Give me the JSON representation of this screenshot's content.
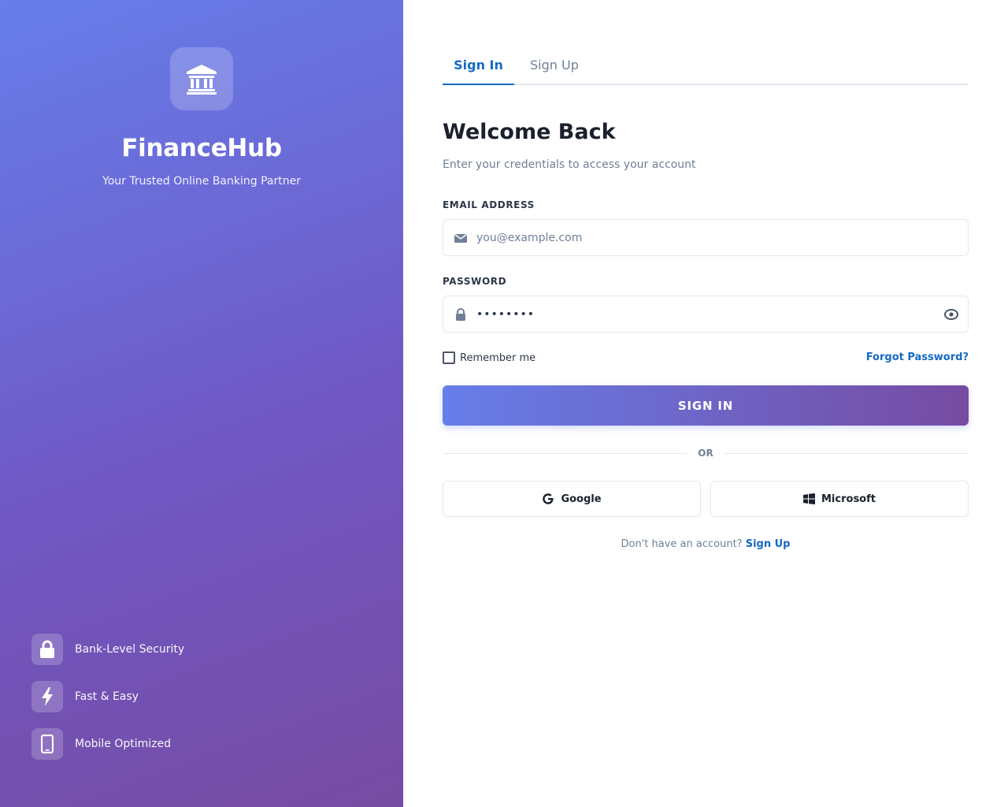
{
  "brand": {
    "name": "FinanceHub",
    "tagline": "Your Trusted Online Banking Partner",
    "logo_icon": "bank-icon"
  },
  "features": [
    {
      "label": "Bank-Level Security",
      "icon": "lock-icon"
    },
    {
      "label": "Fast & Easy",
      "icon": "lightning-bolt-icon"
    },
    {
      "label": "Mobile Optimized",
      "icon": "mobile-phone-icon"
    }
  ],
  "tabs": {
    "sign_in": "Sign In",
    "sign_up": "Sign Up",
    "active": "Sign In"
  },
  "form": {
    "title": "Welcome Back",
    "subtitle": "Enter your credentials to access your account",
    "email_label": "EMAIL ADDRESS",
    "email_placeholder": "you@example.com",
    "email_value": "",
    "password_label": "PASSWORD",
    "password_value": "••••••••",
    "remember_label": "Remember me",
    "remember_checked": false,
    "forgot_label": "Forgot Password?",
    "submit_label": "SIGN IN",
    "divider_label": "OR",
    "google_label": "Google",
    "microsoft_label": "Microsoft",
    "signup_prompt": "Don't have an account?",
    "signup_link": "Sign Up"
  },
  "colors": {
    "gradient_start": "#667eea",
    "gradient_end": "#764ba2",
    "accent": "#1769c2",
    "heading": "#1a202c",
    "muted": "#718096",
    "border": "#e2e8f0"
  }
}
